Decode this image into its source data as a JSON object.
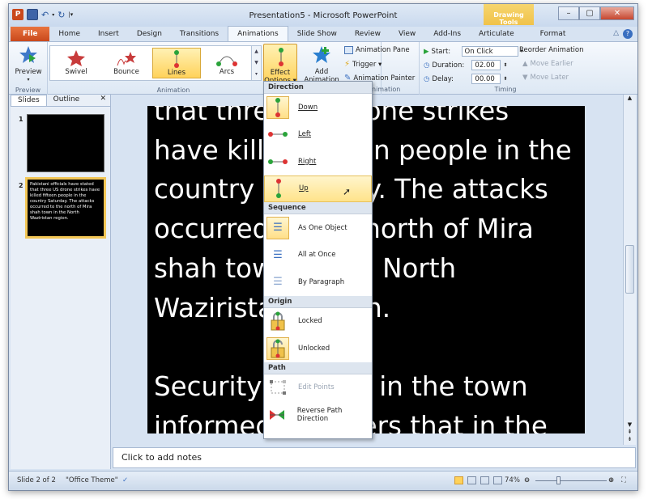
{
  "title": "Presentation5 - Microsoft PowerPoint",
  "contextual_tab_group": "Drawing Tools",
  "window_controls": {
    "minimize": "–",
    "maximize": "▢",
    "close": "✕"
  },
  "tabs": [
    "File",
    "Home",
    "Insert",
    "Design",
    "Transitions",
    "Animations",
    "Slide Show",
    "Review",
    "View",
    "Add-Ins",
    "Articulate",
    "Format"
  ],
  "active_tab": "Animations",
  "ribbon": {
    "preview": {
      "label": "Preview",
      "group": "Preview"
    },
    "animation_group": "Animation",
    "gallery": [
      {
        "label": "Swivel",
        "selected": false
      },
      {
        "label": "Bounce",
        "selected": false
      },
      {
        "label": "Lines",
        "selected": true
      },
      {
        "label": "Arcs",
        "selected": false
      }
    ],
    "effect_options": {
      "line1": "Effect",
      "line2": "Options ▾"
    },
    "add_animation": {
      "line1": "Add",
      "line2": "Animation ▾"
    },
    "animation_pane": "Animation Pane",
    "trigger": "Trigger ▾",
    "animation_painter": "Animation Painter",
    "advanced_group_tail": "nimation",
    "timing": {
      "group": "Timing",
      "start_label": "Start:",
      "start_value": "On Click",
      "duration_label": "Duration:",
      "duration_value": "02.00",
      "delay_label": "Delay:",
      "delay_value": "00.00",
      "reorder_title": "Reorder Animation",
      "move_earlier": "Move Earlier",
      "move_later": "Move Later"
    }
  },
  "left_pane": {
    "tab_slides": "Slides",
    "tab_outline": "Outline",
    "close": "✕",
    "thumb1_number": "1",
    "thumb2_number": "2",
    "thumb2_text": "Pakistani officials have stated that three US drone strikes have killed fifteen people in the country Saturday. The attacks occurred to the north of Mira shah town in the North Waziristan region."
  },
  "slide_lines": [
    "that three US drone strikes",
    "have killed fifteen people in the",
    "country Saturday. The attacks",
    "occurred to the north of Mira",
    "shah town in the North",
    "Waziristan region.",
    "",
    "Security officials in the town",
    "informed reporters that in the first"
  ],
  "notes_placeholder": "Click to add notes",
  "status": {
    "slide": "Slide 2 of 2",
    "theme": "\"Office Theme\"",
    "zoom": "74%"
  },
  "effect_menu": {
    "sections": [
      {
        "header": "Direction",
        "items": [
          {
            "label": "Down",
            "state": "selected"
          },
          {
            "label": "Left",
            "state": "normal"
          },
          {
            "label": "Right",
            "state": "normal"
          },
          {
            "label": "Up",
            "state": "hover"
          }
        ]
      },
      {
        "header": "Sequence",
        "items": [
          {
            "label": "As One Object",
            "state": "selected"
          },
          {
            "label": "All at Once",
            "state": "normal"
          },
          {
            "label": "By Paragraph",
            "state": "normal"
          }
        ]
      },
      {
        "header": "Origin",
        "items": [
          {
            "label": "Locked",
            "state": "normal"
          },
          {
            "label": "Unlocked",
            "state": "selected"
          }
        ]
      },
      {
        "header": "Path",
        "items": [
          {
            "label": "Edit Points",
            "state": "disabled"
          },
          {
            "label": "Reverse Path Direction",
            "state": "normal"
          }
        ]
      }
    ]
  },
  "colors": {
    "accent_file": "#c9481c",
    "selected_gold": "#ffd25a",
    "slide_bg": "#000000",
    "drawing_tools": "#f0c24a"
  }
}
